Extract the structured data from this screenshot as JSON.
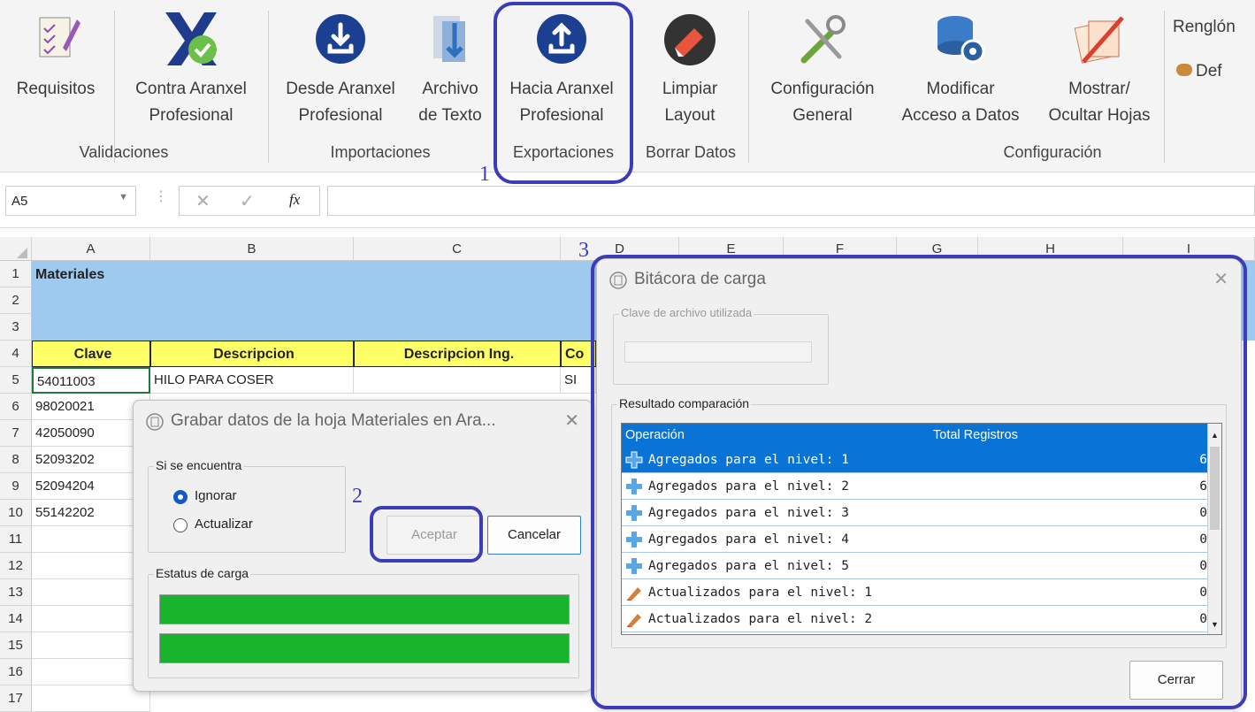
{
  "ribbon": {
    "buttons": [
      {
        "l1": "Requisitos",
        "l2": ""
      },
      {
        "l1": "Contra Aranxel",
        "l2": "Profesional"
      },
      {
        "l1": "Desde Aranxel",
        "l2": "Profesional"
      },
      {
        "l1": "Archivo",
        "l2": "de Texto"
      },
      {
        "l1": "Hacia Aranxel",
        "l2": "Profesional"
      },
      {
        "l1": "Limpiar",
        "l2": "Layout"
      },
      {
        "l1": "Configuración",
        "l2": "General"
      },
      {
        "l1": "Modificar",
        "l2": "Acceso a Datos"
      },
      {
        "l1": "Mostrar/",
        "l2": "Ocultar Hojas"
      }
    ],
    "groups": [
      "Validaciones",
      "Importaciones",
      "Exportaciones",
      "Borrar Datos",
      "Configuración"
    ],
    "right_top": "Renglón",
    "right_bottom": "Def"
  },
  "formula_bar": {
    "name_box": "A5",
    "fx": "fx"
  },
  "columns": [
    "A",
    "B",
    "C",
    "D",
    "E",
    "F",
    "G",
    "H",
    "I"
  ],
  "rows": [
    "1",
    "2",
    "3",
    "4",
    "5",
    "6",
    "7",
    "8",
    "9",
    "10",
    "11",
    "12",
    "13",
    "14",
    "15",
    "16",
    "17"
  ],
  "sheet": {
    "title": "Materiales",
    "headers": [
      "Clave",
      "Descripcion",
      "Descripcion Ing.",
      "Co"
    ],
    "row5": {
      "clave": "54011003",
      "desc": "HILO PARA COSER",
      "d": "SI"
    },
    "claves": [
      "98020021",
      "42050090",
      "52093202",
      "52094204",
      "55142202"
    ]
  },
  "annotations": [
    "1",
    "2",
    "3"
  ],
  "dialog_grabar": {
    "title": "Grabar datos de la hoja Materiales en Ara...",
    "group": "Si se encuentra",
    "option1": "Ignorar",
    "option2": "Actualizar",
    "ok": "Aceptar",
    "cancel": "Cancelar",
    "status_group": "Estatus de carga"
  },
  "dialog_bitacora": {
    "title": "Bitácora de carga",
    "file_group": "Clave de archivo utilizada",
    "result_group": "Resultado comparación",
    "col_operacion": "Operación",
    "col_total": "Total Registros",
    "rows": [
      {
        "op": "Agregados para el nivel: 1",
        "total": "6",
        "icon": "plus-icon"
      },
      {
        "op": "Agregados para el nivel: 2",
        "total": "6",
        "icon": "plus-icon"
      },
      {
        "op": "Agregados para el nivel: 3",
        "total": "0",
        "icon": "plus-icon"
      },
      {
        "op": "Agregados para el nivel: 4",
        "total": "0",
        "icon": "plus-icon"
      },
      {
        "op": "Agregados para el nivel: 5",
        "total": "0",
        "icon": "plus-icon"
      },
      {
        "op": "Actualizados para el nivel: 1",
        "total": "0",
        "icon": "pencil-icon"
      },
      {
        "op": "Actualizados para el nivel: 2",
        "total": "0",
        "icon": "pencil-icon"
      }
    ],
    "close": "Cerrar"
  },
  "colors": {
    "highlight": "#3d3cb8",
    "header_fill": "#9fcaf0",
    "yellow": "#ffff66",
    "green": "#18b42c",
    "select": "#0a74d6"
  }
}
